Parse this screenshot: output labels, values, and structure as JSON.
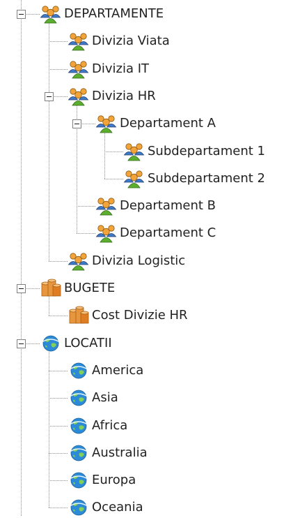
{
  "tree": {
    "nodes": [
      {
        "id": "departamente",
        "label": "DEPARTAMENTE",
        "icon": "people-group-icon",
        "depth": 0,
        "expanded": true
      },
      {
        "id": "divizia-viata",
        "label": "Divizia Viata",
        "icon": "people-group-icon",
        "depth": 1
      },
      {
        "id": "divizia-it",
        "label": "Divizia IT",
        "icon": "people-group-icon",
        "depth": 1
      },
      {
        "id": "divizia-hr",
        "label": "Divizia HR",
        "icon": "people-group-icon",
        "depth": 1,
        "expanded": true
      },
      {
        "id": "departament-a",
        "label": "Departament A",
        "icon": "people-group-icon",
        "depth": 2,
        "expanded": true
      },
      {
        "id": "subdepartament-1",
        "label": "Subdepartament 1",
        "icon": "people-group-icon",
        "depth": 3
      },
      {
        "id": "subdepartament-2",
        "label": "Subdepartament 2",
        "icon": "people-group-icon",
        "depth": 3
      },
      {
        "id": "departament-b",
        "label": "Departament B",
        "icon": "people-group-icon",
        "depth": 2
      },
      {
        "id": "departament-c",
        "label": "Departament C",
        "icon": "people-group-icon",
        "depth": 2
      },
      {
        "id": "divizia-logistic",
        "label": "Divizia Logistic",
        "icon": "people-group-icon",
        "depth": 1
      },
      {
        "id": "bugete",
        "label": "BUGETE",
        "icon": "budget-cylinders-icon",
        "depth": 0,
        "expanded": true
      },
      {
        "id": "cost-divizie-hr",
        "label": "Cost Divizie HR",
        "icon": "budget-cylinders-icon",
        "depth": 1
      },
      {
        "id": "locatii",
        "label": "LOCATII",
        "icon": "globe-icon",
        "depth": 0,
        "expanded": true
      },
      {
        "id": "america",
        "label": "America",
        "icon": "globe-icon",
        "depth": 1
      },
      {
        "id": "asia",
        "label": "Asia",
        "icon": "globe-icon",
        "depth": 1
      },
      {
        "id": "africa",
        "label": "Africa",
        "icon": "globe-icon",
        "depth": 1
      },
      {
        "id": "australia",
        "label": "Australia",
        "icon": "globe-icon",
        "depth": 1
      },
      {
        "id": "europa",
        "label": "Europa",
        "icon": "globe-icon",
        "depth": 1
      },
      {
        "id": "oceania",
        "label": "Oceania",
        "icon": "globe-icon",
        "depth": 1
      }
    ]
  },
  "colors": {
    "connector": "#8c8c8c",
    "people_green": "#5cae2e",
    "people_orange": "#f2a33a",
    "people_blue": "#3f79c9",
    "cylinder": "#e8963e",
    "globe_blue": "#2c8ad6",
    "globe_land": "#7fd15a"
  }
}
